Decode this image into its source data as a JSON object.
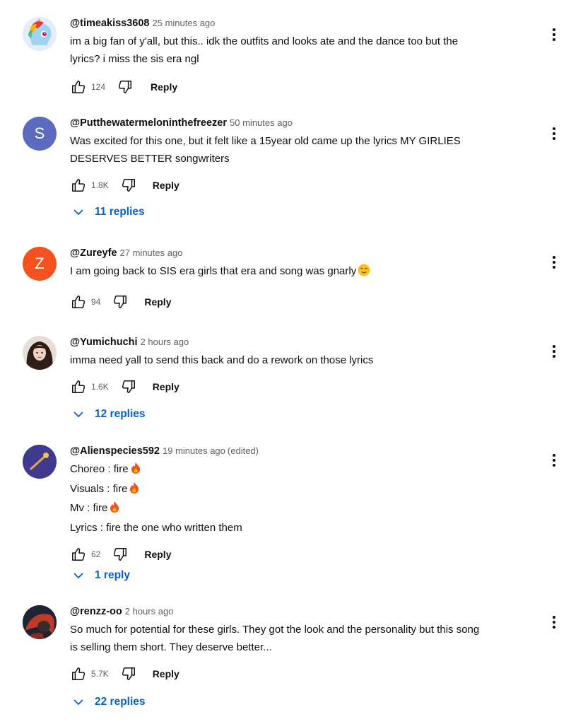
{
  "comments": [
    {
      "handle": "@timeakiss3608",
      "time": "25 minutes ago",
      "lines": [
        "im a big fan of y'all, but this.. idk the outfits and looks ate and the dance too but the",
        "lyrics? i miss the sis era ngl"
      ],
      "likes": "124",
      "reply_label": "Reply",
      "avatar_icon": "pony-avatar-icon"
    },
    {
      "handle": "@Putthewatermelonin thefreezer",
      "time": "50 minutes ago",
      "lines": [
        "Was excited for this one, but it felt like a 15year old came up the lyrics MY GIRLIES",
        "DESERVES BETTER songwriters"
      ],
      "likes": "1.8K",
      "reply_label": "Reply",
      "avatar_letter": "S",
      "avatar_color": "#5c6bc0",
      "replies": "11 replies"
    },
    {
      "handle": "@Zureyfe",
      "time": "27 minutes ago",
      "lines": [
        "I am going back to SIS era girls that era and song was gnarly"
      ],
      "likes": "94",
      "reply_label": "Reply",
      "avatar_letter": "Z",
      "avatar_color": "#f4511e",
      "emoji": "relieved-face-emoji"
    },
    {
      "handle": "@Yumichuchi",
      "time": "2 hours ago",
      "lines": [
        "imma need yall to send this back and do a rework on those lyrics"
      ],
      "likes": "1.6K",
      "reply_label": "Reply",
      "avatar_icon": "portrait-avatar-icon",
      "replies": "12 replies"
    },
    {
      "handle": "@Alienspecies592",
      "time": "19 minutes ago",
      "edited": "(edited)",
      "lines": [
        "Choreo : fire",
        "Visuals : fire",
        "Mv : fire",
        "Lyrics : fire the one who written them"
      ],
      "likes": "62",
      "reply_label": "Reply",
      "avatar_icon": "wand-avatar-icon",
      "replies": "1 reply",
      "emoji": "fire-emoji"
    },
    {
      "handle": "@renzz-oo",
      "time": "2 hours ago",
      "lines": [
        "So much for potential for these girls. They got the look and the personality but this song",
        "is selling them short. They deserve better..."
      ],
      "likes": "5.7K",
      "reply_label": "Reply",
      "avatar_icon": "red-hair-avatar-icon",
      "replies": "22 replies"
    }
  ],
  "icons": {
    "like": "thumbs-up-icon",
    "dislike": "thumbs-down-icon",
    "more": "more-vert-icon",
    "expand": "chevron-down-icon"
  },
  "colors": {
    "link": "#065fd4",
    "meta": "#606060"
  }
}
